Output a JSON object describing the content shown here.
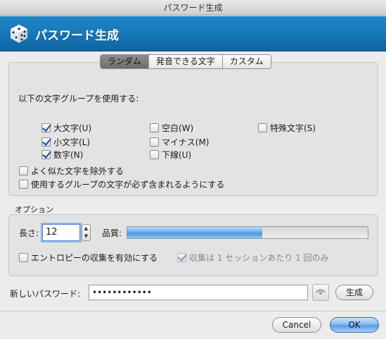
{
  "window": {
    "title": "パスワード生成"
  },
  "banner": {
    "title": "パスワード生成",
    "icon": "dice-icon"
  },
  "tabs": [
    {
      "label": "ランダム",
      "active": true
    },
    {
      "label": "発音できる文字",
      "active": false
    },
    {
      "label": "カスタム",
      "active": false
    }
  ],
  "groups": {
    "heading": "以下の文字グループを使用する:",
    "uppercase": {
      "label": "大文字(U)",
      "checked": true
    },
    "lowercase": {
      "label": "小文字(L)",
      "checked": true
    },
    "digits": {
      "label": "数字(N)",
      "checked": true
    },
    "space": {
      "label": "空白(W)",
      "checked": false
    },
    "minus": {
      "label": "マイナス(M)",
      "checked": false
    },
    "underline": {
      "label": "下線(U)",
      "checked": false
    },
    "special": {
      "label": "特殊文字(S)",
      "checked": false
    },
    "exclude_similar": {
      "label": "よく似た文字を除外する",
      "checked": false
    },
    "each_group": {
      "label": "使用するグループの文字が必ず含まれるようにする",
      "checked": false
    }
  },
  "options": {
    "label": "オプション",
    "length_label": "長さ:",
    "length_value": "12",
    "quality_label": "品質:",
    "quality_fraction": 0.56,
    "entropy": {
      "label": "エントロピーの収集を有効にする",
      "checked": false
    },
    "once_per_session": {
      "label": "収集は 1 セッションあたり 1 回のみ",
      "checked": true,
      "disabled": true
    }
  },
  "password": {
    "label": "新しいパスワード:",
    "value": "••••••••••••",
    "generate_label": "生成"
  },
  "buttons": {
    "cancel": "Cancel",
    "ok": "OK"
  },
  "colors": {
    "banner": "#1678b9",
    "accent": "#5d9ae6"
  }
}
